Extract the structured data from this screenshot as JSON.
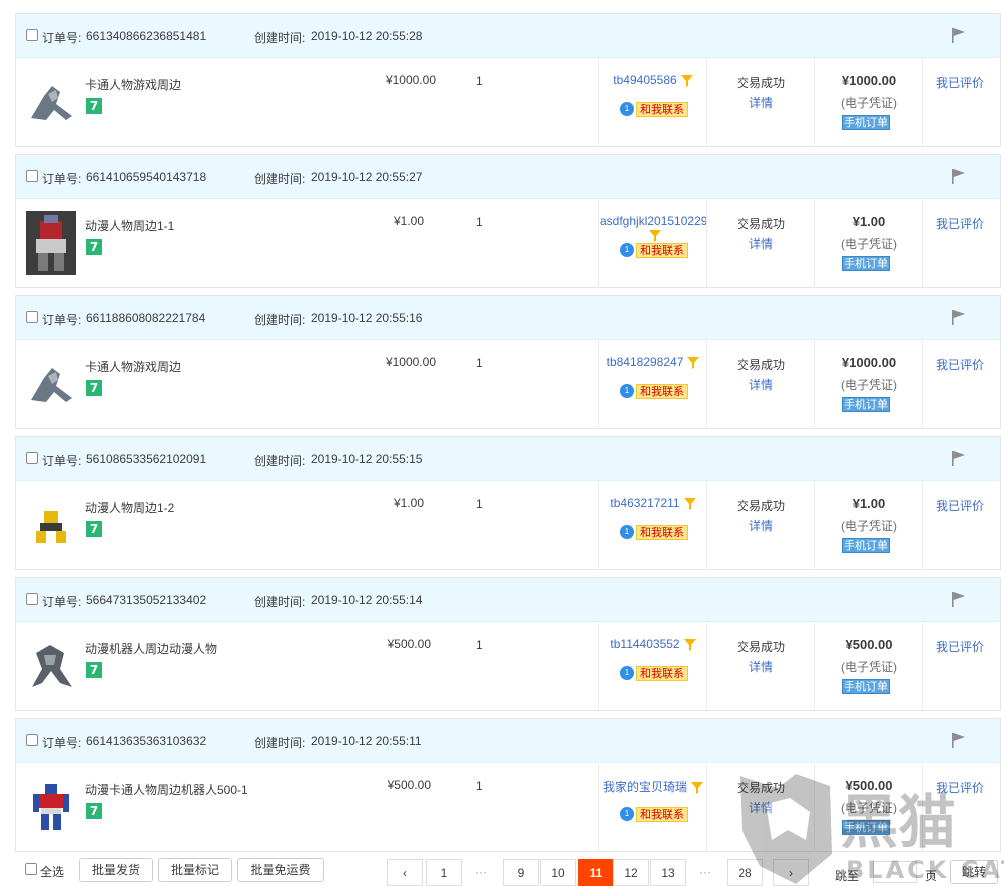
{
  "labels": {
    "order_no": "订单号:",
    "created": "创建时间:",
    "contact": "和我联系",
    "status": "交易成功",
    "detail": "详情",
    "voucher": "(电子凭证)",
    "mobile_order": "手机订单",
    "rated": "我已评价",
    "seven_badge": "7"
  },
  "orders": [
    {
      "order_no": "661340866236851481",
      "created": "2019-10-12 20:55:28",
      "title": "卡通人物游戏周边",
      "price": "¥1000.00",
      "qty": "1",
      "seller": "tb49405586",
      "total": "¥1000.00",
      "thumb_icon": "robot-grey-icon"
    },
    {
      "order_no": "661410659540143718",
      "created": "2019-10-12 20:55:27",
      "title": "动漫人物周边1-1",
      "price": "¥1.00",
      "qty": "1",
      "seller": "asdfghjkl201510229",
      "total": "¥1.00",
      "thumb_icon": "robot-red-icon"
    },
    {
      "order_no": "661188608082221784",
      "created": "2019-10-12 20:55:16",
      "title": "卡通人物游戏周边",
      "price": "¥1000.00",
      "qty": "1",
      "seller": "tb8418298247",
      "total": "¥1000.00",
      "thumb_icon": "robot-grey-icon"
    },
    {
      "order_no": "561086533562102091",
      "created": "2019-10-12 20:55:15",
      "title": "动漫人物周边1-2",
      "price": "¥1.00",
      "qty": "1",
      "seller": "tb463217211",
      "total": "¥1.00",
      "thumb_icon": "robot-yellow-icon"
    },
    {
      "order_no": "566473135052133402",
      "created": "2019-10-12 20:55:14",
      "title": "动漫机器人周边动漫人物",
      "price": "¥500.00",
      "qty": "1",
      "seller": "tb114403552",
      "total": "¥500.00",
      "thumb_icon": "robot-dark-icon"
    },
    {
      "order_no": "661413635363103632",
      "created": "2019-10-12 20:55:11",
      "title": "动漫卡通人物周边机器人500-1",
      "price": "¥500.00",
      "qty": "1",
      "seller": "我家的宝贝琦瑞",
      "total": "¥500.00",
      "thumb_icon": "robot-blue-red-icon"
    }
  ],
  "footer": {
    "select_all": "全选",
    "batch_ship": "批量发货",
    "batch_mark": "批量标记",
    "batch_free_ship": "批量免运费",
    "pages": [
      "1",
      "9",
      "10",
      "11",
      "12",
      "13",
      "28"
    ],
    "ellipsis": "···",
    "current_page": "11",
    "jump_to": "跳至",
    "page_unit": "页",
    "go": "跳转"
  },
  "watermark": {
    "text": "BLACK CAT",
    "glyph": "黑猫"
  },
  "colors": {
    "accent": "#ff4400",
    "link": "#3c6cc6",
    "header_bg": "#eaf8ff",
    "badge_green": "#2bb673"
  }
}
